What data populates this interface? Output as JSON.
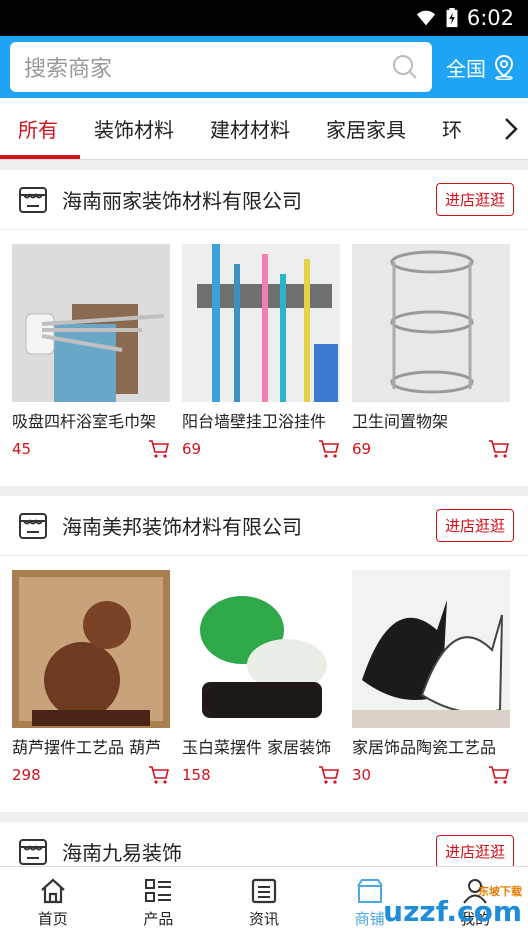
{
  "status": {
    "time": "6:02"
  },
  "search": {
    "placeholder": "搜索商家",
    "region": "全国"
  },
  "tabs": [
    "所有",
    "装饰材料",
    "建材材料",
    "家居家具",
    "环"
  ],
  "shops": [
    {
      "name": "海南丽家装饰材料有限公司",
      "button": "进店逛逛",
      "products": [
        {
          "name": "吸盘四杆浴室毛巾架",
          "price": "45"
        },
        {
          "name": "阳台墙壁挂卫浴挂件",
          "price": "69"
        },
        {
          "name": "卫生间置物架",
          "price": "69"
        }
      ]
    },
    {
      "name": "海南美邦装饰材料有限公司",
      "button": "进店逛逛",
      "products": [
        {
          "name": "葫芦摆件工艺品 葫芦",
          "price": "298"
        },
        {
          "name": "玉白菜摆件 家居装饰",
          "price": "158"
        },
        {
          "name": "家居饰品陶瓷工艺品",
          "price": "30"
        }
      ]
    },
    {
      "name": "海南九易装饰",
      "button": "进店逛逛",
      "products": []
    }
  ],
  "nav": [
    "首页",
    "产品",
    "资讯",
    "商铺",
    "我的"
  ],
  "watermark": {
    "main": "uzzf.com",
    "small": "东坡下载"
  },
  "colors": {
    "primary": "#1fa3f5",
    "accent": "#d0121b"
  }
}
